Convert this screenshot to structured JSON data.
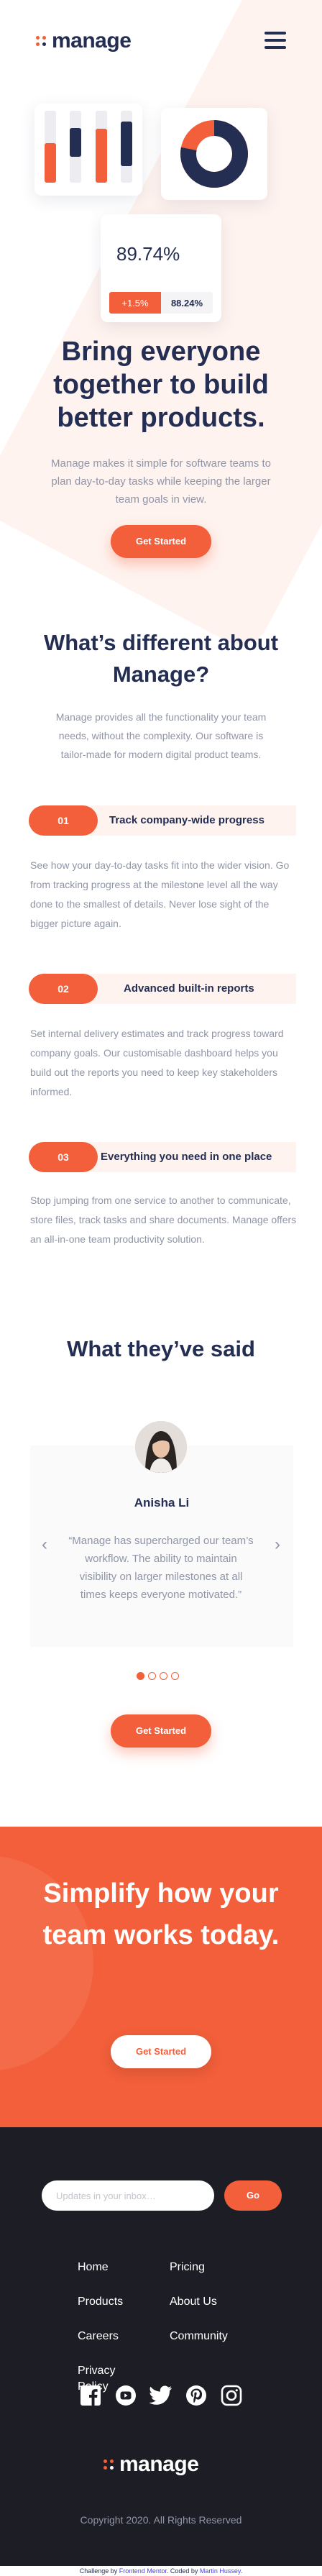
{
  "brand": {
    "name": "manage"
  },
  "colors": {
    "accent": "#F25F3A",
    "navy": "#242D52",
    "muted": "#9095A7",
    "footer_bg": "#1D1E25",
    "pale": "#FFF3EF"
  },
  "header": {
    "menu_icon": "hamburger-icon"
  },
  "hero": {
    "illustration": {
      "bar_chart_values": [
        0.55,
        0.4,
        0.75,
        0.62
      ],
      "donut_share": 0.78,
      "stat_value": "89.74%",
      "stat_change": "+1.5%",
      "stat_secondary": "88.24%"
    },
    "title": "Bring everyone together to build better products.",
    "description": "Manage makes it simple for software teams to plan day-to-day tasks while keeping the larger team goals in view.",
    "cta_label": "Get Started"
  },
  "different": {
    "title": "What’s different about Manage?",
    "description": "Manage provides all the functionality your team needs, without the complexity. Our software is tailor-made for modern digital product teams.",
    "features": [
      {
        "number": "01",
        "title": "Track company-wide progress",
        "text": "See how your day-to-day tasks fit into the wider vision. Go from tracking progress at the milestone level all the way done to the smallest of details. Never lose sight of the bigger picture again."
      },
      {
        "number": "02",
        "title": "Advanced built-in reports",
        "text": "Set internal delivery estimates and track progress toward company goals. Our customisable dashboard helps you build out the reports you need to keep key stakeholders informed."
      },
      {
        "number": "03",
        "title": "Everything you need in one place",
        "text": "Stop jumping from one service to another to communicate, store files, track tasks and share documents. Manage offers an all-in-one team productivity solution."
      }
    ]
  },
  "testimonials": {
    "title": "What they’ve said",
    "current": {
      "name": "Anisha Li",
      "quote": "“Manage has supercharged our team’s workflow. The ability to maintain visibility on larger milestones at all times keeps everyone motivated.”"
    },
    "total_slides": 4,
    "active_slide": 1,
    "cta_label": "Get Started"
  },
  "cta_banner": {
    "title": "Simplify how your team works today.",
    "button_label": "Get Started"
  },
  "footer": {
    "newsletter": {
      "placeholder": "Updates in your inbox…",
      "button_label": "Go"
    },
    "nav_left": [
      "Home",
      "Products",
      "Careers",
      "Privacy Policy"
    ],
    "nav_right": [
      "Pricing",
      "About Us",
      "Community"
    ],
    "socials": [
      "facebook-icon",
      "youtube-icon",
      "twitter-icon",
      "pinterest-icon",
      "instagram-icon"
    ],
    "copyright": "Copyright 2020. All Rights Reserved"
  },
  "attribution": {
    "prefix": "Challenge by",
    "challenge_link": "Frontend Mentor",
    "middle": ". Coded by",
    "author_link": "Martin Hussey",
    "suffix": "."
  }
}
